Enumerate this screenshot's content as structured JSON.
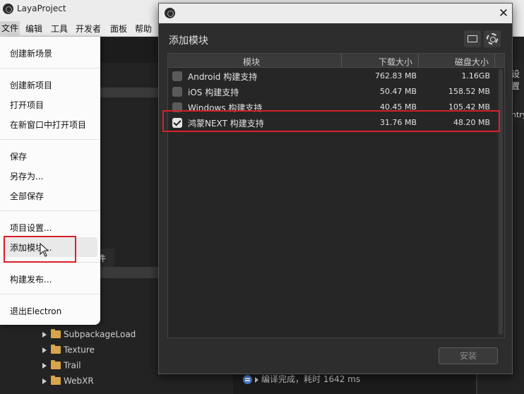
{
  "app": {
    "title": "LayaProject"
  },
  "menubar": [
    "文件",
    "编辑",
    "工具",
    "开发者",
    "面板",
    "帮助"
  ],
  "file_menu": {
    "items": [
      "创建新场景",
      "创建新项目",
      "打开项目",
      "在新窗口中打开项目",
      "保存",
      "另存为...",
      "全部保存",
      "项目设置...",
      "添加模块...",
      "构建发布...",
      "退出Electron"
    ]
  },
  "tree": [
    "SubpackageLoad",
    "Texture",
    "Trail",
    "WebXR"
  ],
  "partial": {
    "tab_fragment": "件",
    "right_label": "设置",
    "right_label2": "ntry"
  },
  "console": {
    "message": "编译完成，耗时 1642 ms"
  },
  "dialog": {
    "title": "添加模块",
    "columns": [
      "模块",
      "下载大小",
      "磁盘大小"
    ],
    "rows": [
      {
        "name": "Android 构建支持",
        "download": "762.83 MB",
        "disk": "1.16GB",
        "checked": false
      },
      {
        "name": "iOS 构建支持",
        "download": "50.47 MB",
        "disk": "158.52 MB",
        "checked": false
      },
      {
        "name": "Windows 构建支持",
        "download": "40.45 MB",
        "disk": "105.42 MB",
        "checked": false
      },
      {
        "name": "鸿蒙NEXT 构建支持",
        "download": "31.76 MB",
        "disk": "48.20 MB",
        "checked": true
      }
    ],
    "install_label": "安装",
    "close_glyph": "✕"
  },
  "colors": {
    "highlight": "#d8202a",
    "folder": "#d9a54c",
    "dialog_bg": "#2d2d2d"
  },
  "icons": [
    "app-logo-icon",
    "folder-open-icon",
    "gear-icon",
    "close-icon",
    "folder-icon",
    "chevron-right-icon",
    "cursor-icon",
    "console-info-icon"
  ]
}
